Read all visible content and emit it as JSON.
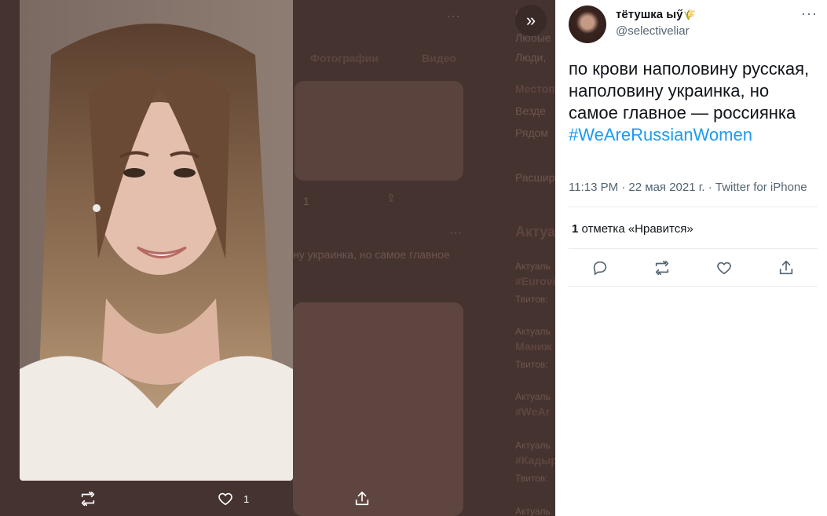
{
  "background": {
    "tabs": [
      "Фотографии",
      "Видео"
    ],
    "snippet_text": "ну украинка, но самое главное",
    "reply_count": "1",
    "sidebar_lines": [
      "Люди,",
      "Местоп",
      "Везде",
      "Рядом",
      "Расшир",
      "Актуа",
      "Актуаль",
      "#Eurovi",
      "Твитов:",
      "Актуаль",
      "Маниж",
      "Твитов:",
      "Актуаль",
      "#WeAr",
      "Актуаль",
      "#Кадыр",
      "Твитов:",
      "Актуаль"
    ]
  },
  "media": {
    "expand_icon": "double-chevron-right-icon",
    "like_count": "1",
    "icons": [
      "retweet-icon",
      "heart-icon",
      "share-icon"
    ]
  },
  "tweet": {
    "display_name": "тётушка ыӳ",
    "emoji": "🌾",
    "handle": "@selectiveliar",
    "text": "по крови наполовину русская, наполовину украинка, но самое главное — россиянка",
    "hashtag": "#WeAreRussianWomen",
    "meta": "11:13 PM · 22 мая 2021 г. · Twitter for iPhone",
    "likes_count": "1",
    "likes_label": "отметка «Нравится»",
    "more_label": "···"
  },
  "colors": {
    "accent": "#1d9bf0",
    "text_primary": "#0f1419",
    "text_secondary": "#536471",
    "overlay_bg": "#453330"
  }
}
